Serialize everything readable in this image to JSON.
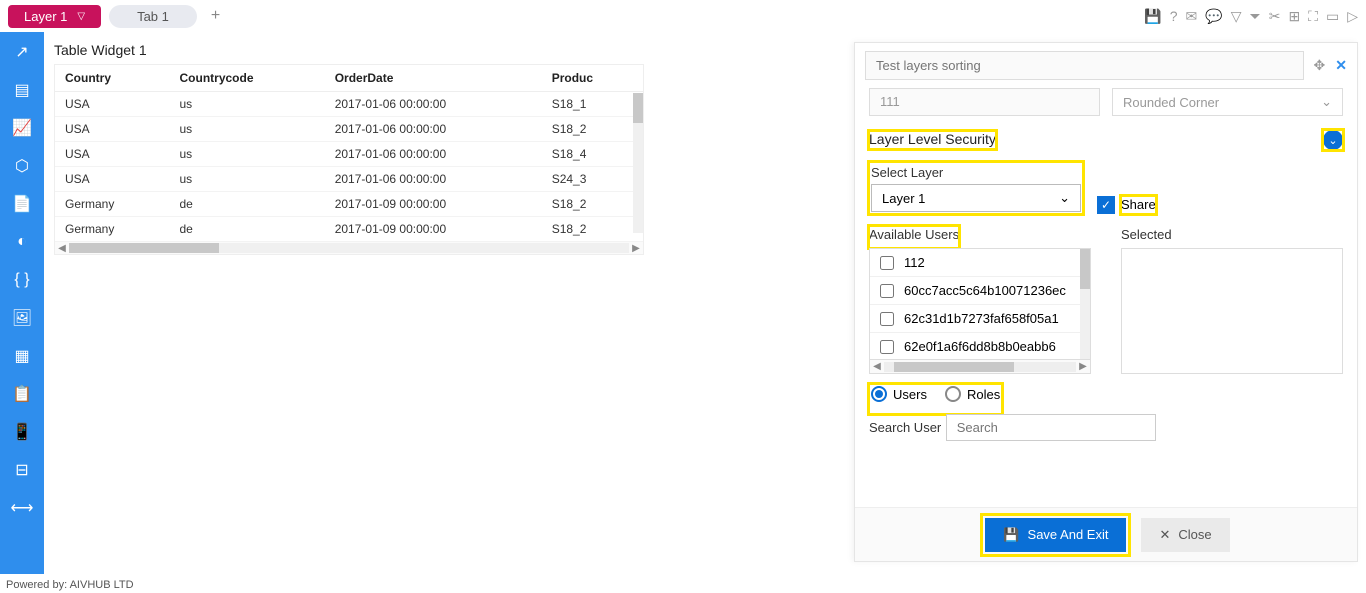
{
  "topbar": {
    "layer_label": "Layer 1",
    "tab_label": "Tab 1"
  },
  "widget": {
    "title": "Table Widget 1",
    "columns": [
      "Country",
      "Countrycode",
      "OrderDate",
      "Produc"
    ],
    "rows": [
      {
        "c0": "USA",
        "c1": "us",
        "c2": "2017-01-06 00:00:00",
        "c3": "S18_1"
      },
      {
        "c0": "USA",
        "c1": "us",
        "c2": "2017-01-06 00:00:00",
        "c3": "S18_2"
      },
      {
        "c0": "USA",
        "c1": "us",
        "c2": "2017-01-06 00:00:00",
        "c3": "S18_4"
      },
      {
        "c0": "USA",
        "c1": "us",
        "c2": "2017-01-06 00:00:00",
        "c3": "S24_3"
      },
      {
        "c0": "Germany",
        "c1": "de",
        "c2": "2017-01-09 00:00:00",
        "c3": "S18_2"
      },
      {
        "c0": "Germany",
        "c1": "de",
        "c2": "2017-01-09 00:00:00",
        "c3": "S18_2"
      }
    ]
  },
  "panel": {
    "search_placeholder": "Test layers sorting",
    "prev_input": "111",
    "prev_select": "Rounded Corner",
    "section_title": "Layer Level Security",
    "select_layer_label": "Select Layer",
    "select_layer_value": "Layer 1",
    "share_label": "Share",
    "available_label": "Available Users",
    "selected_label": "Selected",
    "users": [
      "112",
      "60cc7acc5c64b10071236ec",
      "62c31d1b7273faf658f05a1",
      "62e0f1a6f6dd8b8b0eabb6"
    ],
    "radio_users": "Users",
    "radio_roles": "Roles",
    "search_user_label": "Search User",
    "search_user_placeholder": "Search",
    "save_label": "Save And Exit",
    "close_label": "Close"
  },
  "footer": "Powered by:  AIVHUB LTD"
}
